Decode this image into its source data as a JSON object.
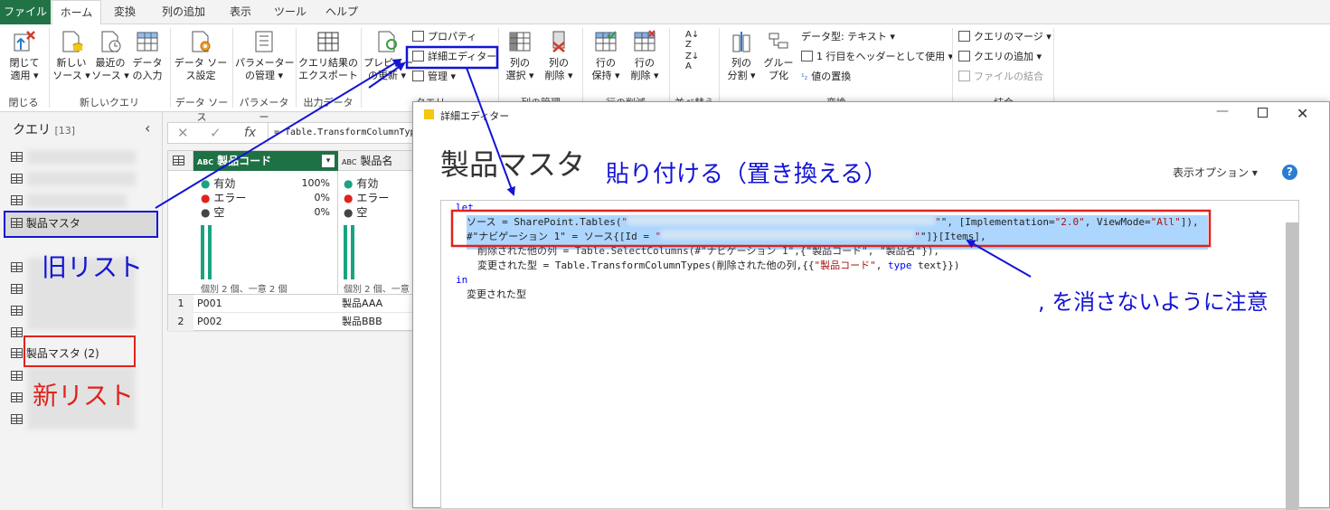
{
  "tabs": {
    "file": "ファイル",
    "home": "ホーム",
    "transform": "変換",
    "add_column": "列の追加",
    "view": "表示",
    "tools": "ツール",
    "help": "ヘルプ"
  },
  "ribbon": {
    "close_apply": "閉じて\n適用 ▾",
    "close_group": "閉じる",
    "new_source": "新しい\nソース ▾",
    "recent_sources": "最近の\nソース ▾",
    "enter_data": "データ\nの入力",
    "new_query_group": "新しいクエリ",
    "ds_settings": "データ ソー\nス設定",
    "ds_group": "データ ソース",
    "manage_params": "パラメーター\nの管理 ▾",
    "params_group": "パラメーター",
    "export_query": "クエリ結果の\nエクスポート",
    "output_group": "出力データ",
    "preview_refresh": "プレビュー\nの更新 ▾",
    "properties": "プロパティ",
    "advanced_editor": "詳細エディター",
    "manage": "管理 ▾",
    "query_group": "クエリ",
    "choose_columns": "列の\n選択 ▾",
    "remove_columns": "列の\n削除 ▾",
    "manage_columns_group": "列の管理",
    "keep_rows": "行の\n保持 ▾",
    "remove_rows": "行の\n削除 ▾",
    "reduce_rows_group": "行の削減",
    "sort_group": "並べ替え",
    "split_column": "列の\n分割 ▾",
    "group_by": "グルー\nプ化",
    "data_type": "データ型: テキスト ▾",
    "first_row_header": "1 行目をヘッダーとして使用 ▾",
    "replace_values": "値の置換",
    "transform_group": "変換",
    "merge_queries": "クエリのマージ ▾",
    "append_queries": "クエリの追加 ▾",
    "combine_files": "ファイルの結合",
    "combine_group": "結合"
  },
  "queries": {
    "title": "クエリ",
    "count": "[13]",
    "item_master": "製品マスタ",
    "item_master2": "製品マスタ (2)"
  },
  "formula": {
    "text": "= Table.TransformColumnTypes"
  },
  "grid": {
    "col1": "製品コード",
    "col2": "製品名",
    "type_icon": "ABC",
    "valid": "有効",
    "error": "エラー",
    "empty": "空",
    "valid_pct": "100%",
    "error_pct": "0%",
    "empty_pct": "0%",
    "distinct": "個別 2 個、一意 2 個",
    "distinct2": "個別 2 個、一意",
    "rows": [
      [
        "1",
        "P001",
        "製品AAA"
      ],
      [
        "2",
        "P002",
        "製品BBB"
      ]
    ]
  },
  "dialog": {
    "title": "詳細エディター",
    "heading": "製品マスタ",
    "display_options": "表示オプション ▾",
    "help": "?",
    "code": {
      "let": "let",
      "l1_a": "ソース = SharePoint.Tables(",
      "l1_q": "\"",
      "l1_b": "\", [Implementation=",
      "l1_s1": "\"2.0\"",
      "l1_c": ", ViewMode=",
      "l1_s2": "\"All\"",
      "l1_d": "]),",
      "l2_a": "#\"ナビゲーション 1\" = ソース{[Id = ",
      "l2_q": "\"",
      "l2_b": "\"]}[Items],",
      "l3": "削除された他の列 = Table.SelectColumns(#\"ナビゲーション 1\",{\"製品コード\", \"製品名\"}),",
      "l4_a": "変更された型 = Table.TransformColumnTypes(削除された他の列,{{",
      "l4_s": "\"製品コード\"",
      "l4_b": ", ",
      "l4_kw": "type",
      "l4_c": " text}})",
      "in": "in",
      "last": "変更された型"
    }
  },
  "annotations": {
    "paste": "貼り付ける（置き換える）",
    "old_list": "旧リスト",
    "new_list": "新リスト",
    "comma_note": ", を消さないように注意"
  },
  "colors": {
    "excel_green": "#217346",
    "annotation_blue": "#1414d6",
    "annotation_red": "#e0231d",
    "highlight": "#add6ff",
    "teal": "#1aa37f"
  }
}
